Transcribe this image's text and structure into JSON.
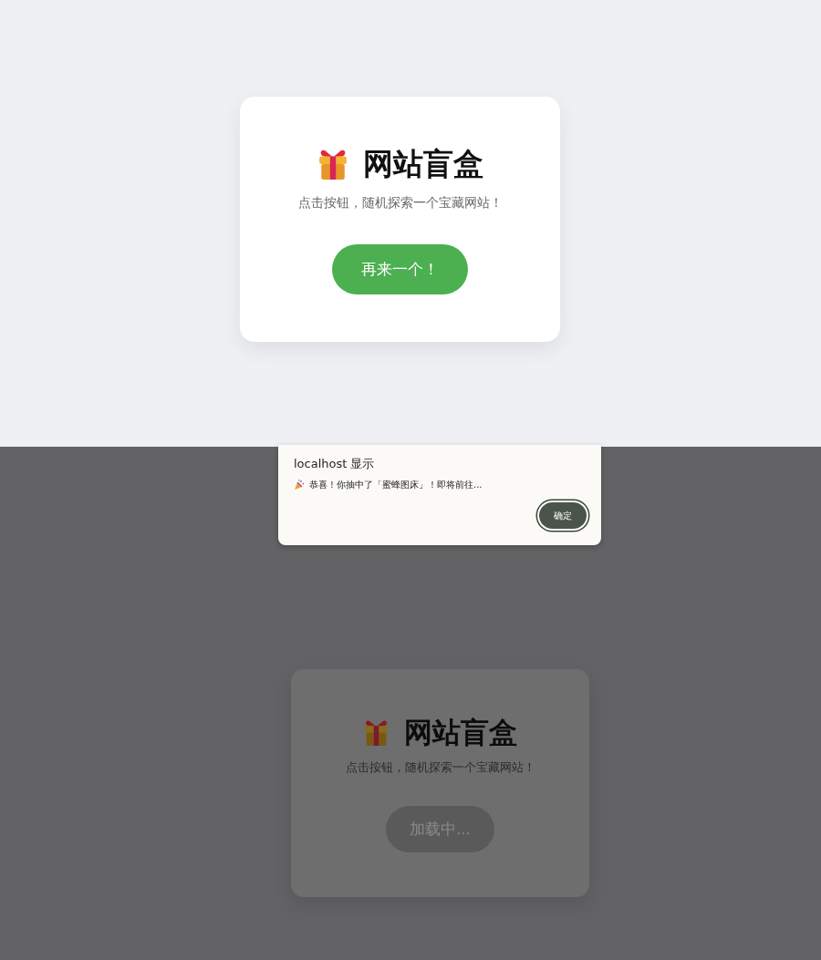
{
  "screens": [
    {
      "kind": "page",
      "card": {
        "title": "网站盲盒",
        "subtitle": "点击按钮，随机探索一个宝藏网站！",
        "button": {
          "label": "再来一个！",
          "disabled": false
        }
      }
    },
    {
      "kind": "alert",
      "dialog": {
        "title": "localhost 显示",
        "message": "恭喜！你抽中了「蜜蜂图床」！即将前往...",
        "ok_button": "确定"
      },
      "card": {
        "title": "网站盲盒",
        "subtitle": "点击按钮，随机探索一个宝藏网站！",
        "button": {
          "label": "加载中...",
          "disabled": true
        }
      }
    }
  ]
}
